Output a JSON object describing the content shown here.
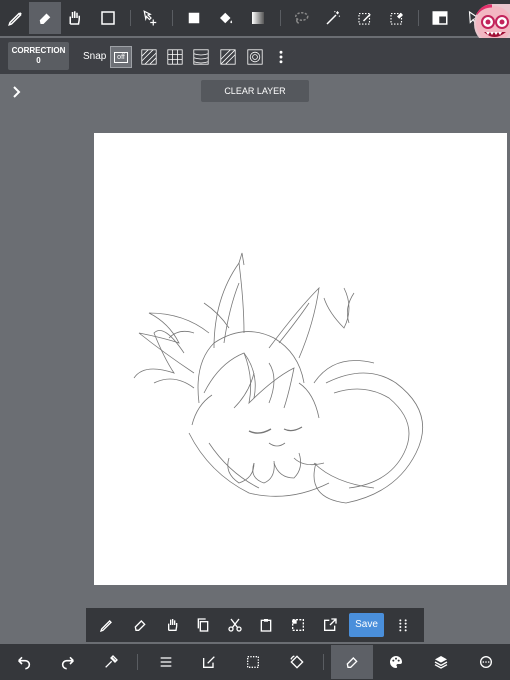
{
  "top_toolbar": {
    "tools": [
      "pen-icon",
      "eraser-icon",
      "hand-icon",
      "rectangle-select-icon",
      "move-icon",
      "fill-shape-icon",
      "bucket-icon",
      "gradient-icon",
      "lasso-icon",
      "magic-wand-icon",
      "select-pen-icon",
      "select-eraser-icon",
      "layout-icon",
      "cursor-icon"
    ],
    "active_tool": "eraser-icon"
  },
  "secondary_toolbar": {
    "correction_label": "CORRECTION",
    "correction_value": "0",
    "snap_label": "Snap",
    "snap_off_label": "off",
    "snap_modes": [
      "parallel-lines",
      "grid",
      "curve-lines",
      "perspective",
      "concentric"
    ]
  },
  "canvas_area": {
    "clear_layer_label": "CLEAR LAYER"
  },
  "action_bar": {
    "save_label": "Save",
    "items": [
      "pen-icon",
      "eraser-icon",
      "hand-icon",
      "copy-icon",
      "scissors-icon",
      "paste-icon",
      "deselect-icon",
      "export-icon"
    ]
  },
  "bottom_toolbar": {
    "items": [
      "undo-icon",
      "redo-icon",
      "eyedropper-icon",
      "menu-icon",
      "edit-icon",
      "selection-icon",
      "rotate-icon",
      "eraser-icon",
      "palette-icon",
      "layers-icon",
      "settings-icon"
    ],
    "active_item": "eraser-icon"
  },
  "colors": {
    "toolbar_bg": "#35373b",
    "workspace_bg": "#6b6e73",
    "accent": "#4a8fdb"
  }
}
